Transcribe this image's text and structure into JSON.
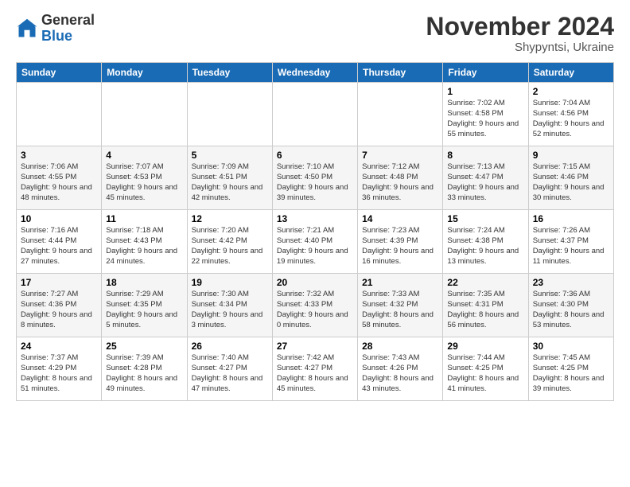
{
  "logo": {
    "general": "General",
    "blue": "Blue"
  },
  "title": "November 2024",
  "location": "Shypyntsi, Ukraine",
  "days_of_week": [
    "Sunday",
    "Monday",
    "Tuesday",
    "Wednesday",
    "Thursday",
    "Friday",
    "Saturday"
  ],
  "weeks": [
    [
      {
        "day": "",
        "info": ""
      },
      {
        "day": "",
        "info": ""
      },
      {
        "day": "",
        "info": ""
      },
      {
        "day": "",
        "info": ""
      },
      {
        "day": "",
        "info": ""
      },
      {
        "day": "1",
        "info": "Sunrise: 7:02 AM\nSunset: 4:58 PM\nDaylight: 9 hours\nand 55 minutes."
      },
      {
        "day": "2",
        "info": "Sunrise: 7:04 AM\nSunset: 4:56 PM\nDaylight: 9 hours\nand 52 minutes."
      }
    ],
    [
      {
        "day": "3",
        "info": "Sunrise: 7:06 AM\nSunset: 4:55 PM\nDaylight: 9 hours\nand 48 minutes."
      },
      {
        "day": "4",
        "info": "Sunrise: 7:07 AM\nSunset: 4:53 PM\nDaylight: 9 hours\nand 45 minutes."
      },
      {
        "day": "5",
        "info": "Sunrise: 7:09 AM\nSunset: 4:51 PM\nDaylight: 9 hours\nand 42 minutes."
      },
      {
        "day": "6",
        "info": "Sunrise: 7:10 AM\nSunset: 4:50 PM\nDaylight: 9 hours\nand 39 minutes."
      },
      {
        "day": "7",
        "info": "Sunrise: 7:12 AM\nSunset: 4:48 PM\nDaylight: 9 hours\nand 36 minutes."
      },
      {
        "day": "8",
        "info": "Sunrise: 7:13 AM\nSunset: 4:47 PM\nDaylight: 9 hours\nand 33 minutes."
      },
      {
        "day": "9",
        "info": "Sunrise: 7:15 AM\nSunset: 4:46 PM\nDaylight: 9 hours\nand 30 minutes."
      }
    ],
    [
      {
        "day": "10",
        "info": "Sunrise: 7:16 AM\nSunset: 4:44 PM\nDaylight: 9 hours\nand 27 minutes."
      },
      {
        "day": "11",
        "info": "Sunrise: 7:18 AM\nSunset: 4:43 PM\nDaylight: 9 hours\nand 24 minutes."
      },
      {
        "day": "12",
        "info": "Sunrise: 7:20 AM\nSunset: 4:42 PM\nDaylight: 9 hours\nand 22 minutes."
      },
      {
        "day": "13",
        "info": "Sunrise: 7:21 AM\nSunset: 4:40 PM\nDaylight: 9 hours\nand 19 minutes."
      },
      {
        "day": "14",
        "info": "Sunrise: 7:23 AM\nSunset: 4:39 PM\nDaylight: 9 hours\nand 16 minutes."
      },
      {
        "day": "15",
        "info": "Sunrise: 7:24 AM\nSunset: 4:38 PM\nDaylight: 9 hours\nand 13 minutes."
      },
      {
        "day": "16",
        "info": "Sunrise: 7:26 AM\nSunset: 4:37 PM\nDaylight: 9 hours\nand 11 minutes."
      }
    ],
    [
      {
        "day": "17",
        "info": "Sunrise: 7:27 AM\nSunset: 4:36 PM\nDaylight: 9 hours\nand 8 minutes."
      },
      {
        "day": "18",
        "info": "Sunrise: 7:29 AM\nSunset: 4:35 PM\nDaylight: 9 hours\nand 5 minutes."
      },
      {
        "day": "19",
        "info": "Sunrise: 7:30 AM\nSunset: 4:34 PM\nDaylight: 9 hours\nand 3 minutes."
      },
      {
        "day": "20",
        "info": "Sunrise: 7:32 AM\nSunset: 4:33 PM\nDaylight: 9 hours\nand 0 minutes."
      },
      {
        "day": "21",
        "info": "Sunrise: 7:33 AM\nSunset: 4:32 PM\nDaylight: 8 hours\nand 58 minutes."
      },
      {
        "day": "22",
        "info": "Sunrise: 7:35 AM\nSunset: 4:31 PM\nDaylight: 8 hours\nand 56 minutes."
      },
      {
        "day": "23",
        "info": "Sunrise: 7:36 AM\nSunset: 4:30 PM\nDaylight: 8 hours\nand 53 minutes."
      }
    ],
    [
      {
        "day": "24",
        "info": "Sunrise: 7:37 AM\nSunset: 4:29 PM\nDaylight: 8 hours\nand 51 minutes."
      },
      {
        "day": "25",
        "info": "Sunrise: 7:39 AM\nSunset: 4:28 PM\nDaylight: 8 hours\nand 49 minutes."
      },
      {
        "day": "26",
        "info": "Sunrise: 7:40 AM\nSunset: 4:27 PM\nDaylight: 8 hours\nand 47 minutes."
      },
      {
        "day": "27",
        "info": "Sunrise: 7:42 AM\nSunset: 4:27 PM\nDaylight: 8 hours\nand 45 minutes."
      },
      {
        "day": "28",
        "info": "Sunrise: 7:43 AM\nSunset: 4:26 PM\nDaylight: 8 hours\nand 43 minutes."
      },
      {
        "day": "29",
        "info": "Sunrise: 7:44 AM\nSunset: 4:25 PM\nDaylight: 8 hours\nand 41 minutes."
      },
      {
        "day": "30",
        "info": "Sunrise: 7:45 AM\nSunset: 4:25 PM\nDaylight: 8 hours\nand 39 minutes."
      }
    ]
  ]
}
